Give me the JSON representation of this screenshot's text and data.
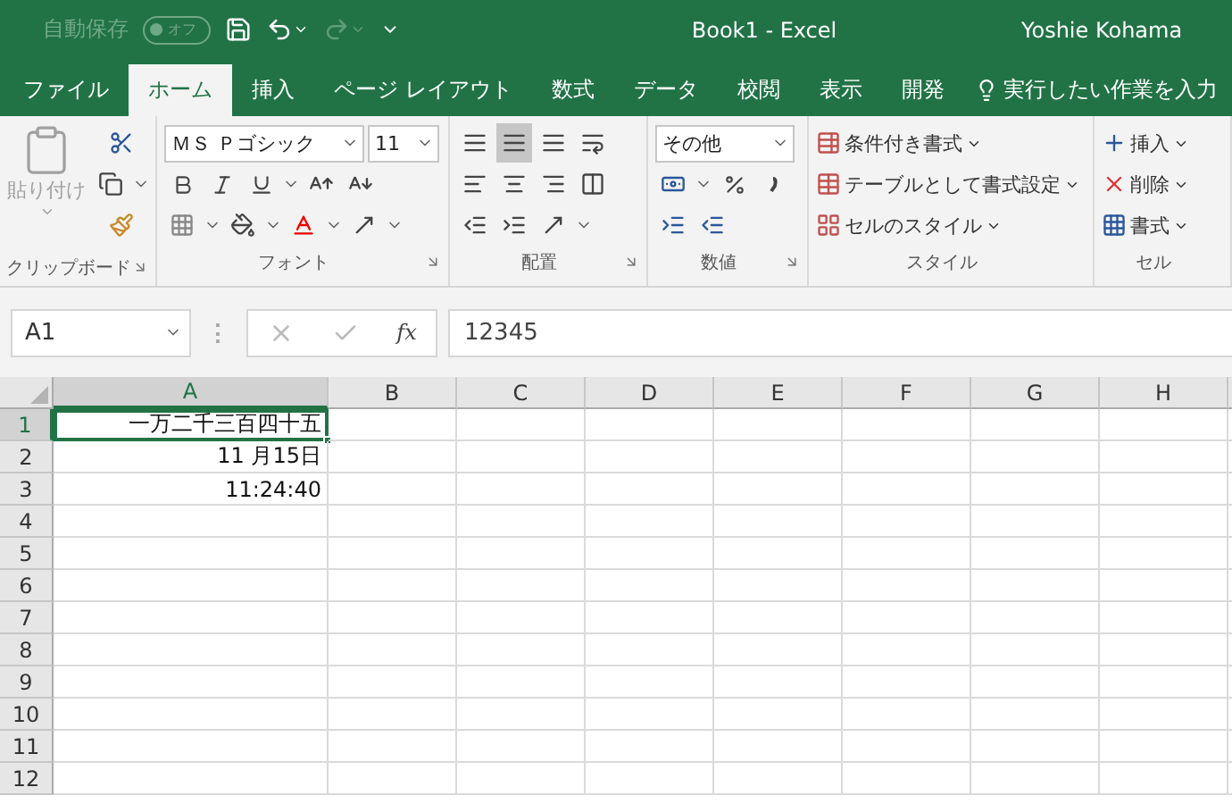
{
  "title_bar": {
    "autosave_label": "自動保存",
    "autosave": {
      "on": false,
      "label": "オフ"
    },
    "undo_disabled": false,
    "redo_disabled": true,
    "title": "Book1  -  Excel",
    "user": "Yoshie Kohama"
  },
  "tabs": [
    {
      "label": "ファイル",
      "selected": false
    },
    {
      "label": "ホーム",
      "selected": true
    },
    {
      "label": "挿入",
      "selected": false
    },
    {
      "label": "ページ レイアウト",
      "selected": false
    },
    {
      "label": "数式",
      "selected": false
    },
    {
      "label": "データ",
      "selected": false
    },
    {
      "label": "校閲",
      "selected": false
    },
    {
      "label": "表示",
      "selected": false
    },
    {
      "label": "開発",
      "selected": false
    }
  ],
  "tell_me": "実行したい作業を入力",
  "ribbon": {
    "clipboard": {
      "label": "クリップボード",
      "paste_label": "貼り付け",
      "paste_disabled": true
    },
    "font": {
      "label": "フォント",
      "font_name": "ＭＳ Ｐゴシック",
      "font_size": "11"
    },
    "alignment": {
      "label": "配置",
      "buttons": [
        {
          "kind": "top",
          "selected": false
        },
        {
          "kind": "middle",
          "selected": true
        },
        {
          "kind": "bottom",
          "selected": false
        },
        {
          "kind": "wrap",
          "selected": false
        },
        {
          "kind": "left",
          "selected": false
        },
        {
          "kind": "center",
          "selected": false
        },
        {
          "kind": "right",
          "selected": false
        },
        {
          "kind": "merge",
          "selected": false
        },
        {
          "kind": "outdent",
          "selected": false
        },
        {
          "kind": "indent",
          "selected": false
        },
        {
          "kind": "orientation",
          "selected": false
        }
      ]
    },
    "number": {
      "label": "数値",
      "format": "その他"
    },
    "styles": {
      "label": "スタイル",
      "items": [
        "条件付き書式",
        "テーブルとして書式設定",
        "セルのスタイル"
      ]
    },
    "cells": {
      "label": "セル",
      "items": [
        "挿入",
        "削除",
        "書式"
      ]
    }
  },
  "formula_bar": {
    "name_box": "A1",
    "cancel_disabled": true,
    "enter_disabled": true,
    "function_label": "fx",
    "value": "12345"
  },
  "grid": {
    "columns": [
      {
        "label": "A",
        "selected": true
      },
      {
        "label": "B",
        "selected": false
      },
      {
        "label": "C",
        "selected": false
      },
      {
        "label": "D",
        "selected": false
      },
      {
        "label": "E",
        "selected": false
      },
      {
        "label": "F",
        "selected": false
      },
      {
        "label": "G",
        "selected": false
      },
      {
        "label": "H",
        "selected": false
      }
    ],
    "rows": [
      {
        "label": "1",
        "selected": true,
        "cells": [
          {
            "text": "一万二千三百四十五",
            "active": true
          }
        ]
      },
      {
        "label": "2",
        "selected": false,
        "cells": [
          {
            "text": "11 月15日",
            "active": false
          }
        ]
      },
      {
        "label": "3",
        "selected": false,
        "cells": [
          {
            "text": "11:24:40",
            "active": false
          }
        ]
      },
      {
        "label": "4",
        "selected": false
      },
      {
        "label": "5",
        "selected": false
      },
      {
        "label": "6",
        "selected": false
      },
      {
        "label": "7",
        "selected": false
      },
      {
        "label": "8",
        "selected": false
      },
      {
        "label": "9",
        "selected": false
      },
      {
        "label": "10",
        "selected": false
      },
      {
        "label": "11",
        "selected": false
      },
      {
        "label": "12",
        "selected": false
      }
    ]
  }
}
